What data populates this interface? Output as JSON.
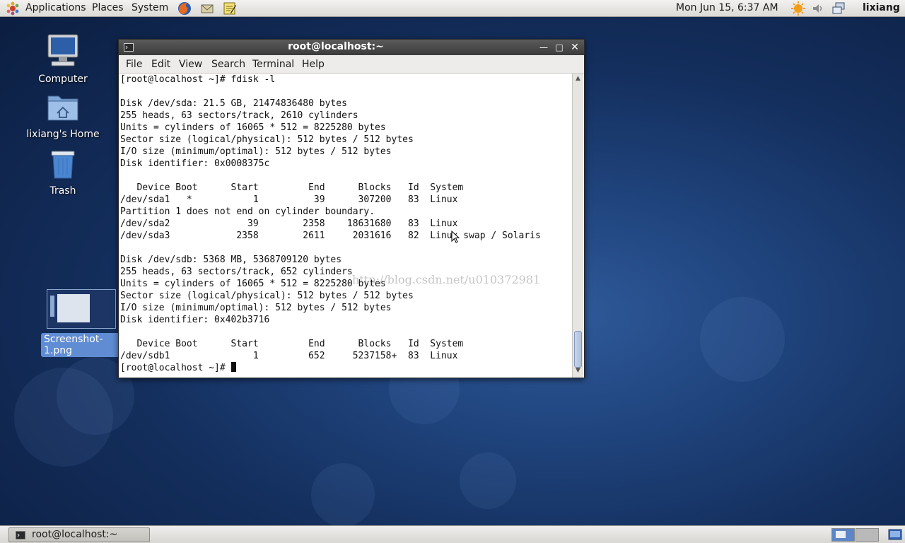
{
  "top_panel": {
    "menus": [
      "Applications",
      "Places",
      "System"
    ],
    "clock": "Mon Jun 15,  6:37 AM",
    "user": "lixiang",
    "icons": [
      "gnome-foot-icon",
      "firefox-icon",
      "mail-icon",
      "notes-icon",
      "update-icon",
      "volume-icon",
      "network-icon"
    ]
  },
  "desktop": {
    "icons": [
      {
        "label": "Computer",
        "icon": "computer-icon"
      },
      {
        "label": "lixiang's Home",
        "icon": "home-folder-icon"
      },
      {
        "label": "Trash",
        "icon": "trash-icon"
      },
      {
        "label": "Screenshot-1.png",
        "icon": "image-thumbnail-icon"
      }
    ]
  },
  "terminal": {
    "title": "root@localhost:~",
    "menu": [
      "File",
      "Edit",
      "View",
      "Search",
      "Terminal",
      "Help"
    ],
    "lines": [
      "[root@localhost ~]# fdisk -l",
      "",
      "Disk /dev/sda: 21.5 GB, 21474836480 bytes",
      "255 heads, 63 sectors/track, 2610 cylinders",
      "Units = cylinders of 16065 * 512 = 8225280 bytes",
      "Sector size (logical/physical): 512 bytes / 512 bytes",
      "I/O size (minimum/optimal): 512 bytes / 512 bytes",
      "Disk identifier: 0x0008375c",
      "",
      "   Device Boot      Start         End      Blocks   Id  System",
      "/dev/sda1   *           1          39      307200   83  Linux",
      "Partition 1 does not end on cylinder boundary.",
      "/dev/sda2              39        2358    18631680   83  Linux",
      "/dev/sda3            2358        2611     2031616   82  Linux swap / Solaris",
      "",
      "Disk /dev/sdb: 5368 MB, 5368709120 bytes",
      "255 heads, 63 sectors/track, 652 cylinders",
      "Units = cylinders of 16065 * 512 = 8225280 bytes",
      "Sector size (logical/physical): 512 bytes / 512 bytes",
      "I/O size (minimum/optimal): 512 bytes / 512 bytes",
      "Disk identifier: 0x402b3716",
      "",
      "   Device Boot      Start         End      Blocks   Id  System",
      "/dev/sdb1               1         652     5237158+  83  Linux"
    ],
    "prompt": "[root@localhost ~]# ",
    "watermark": "http://blog.csdn.net/u010372981"
  },
  "taskbar": {
    "task_label": "root@localhost:~"
  }
}
